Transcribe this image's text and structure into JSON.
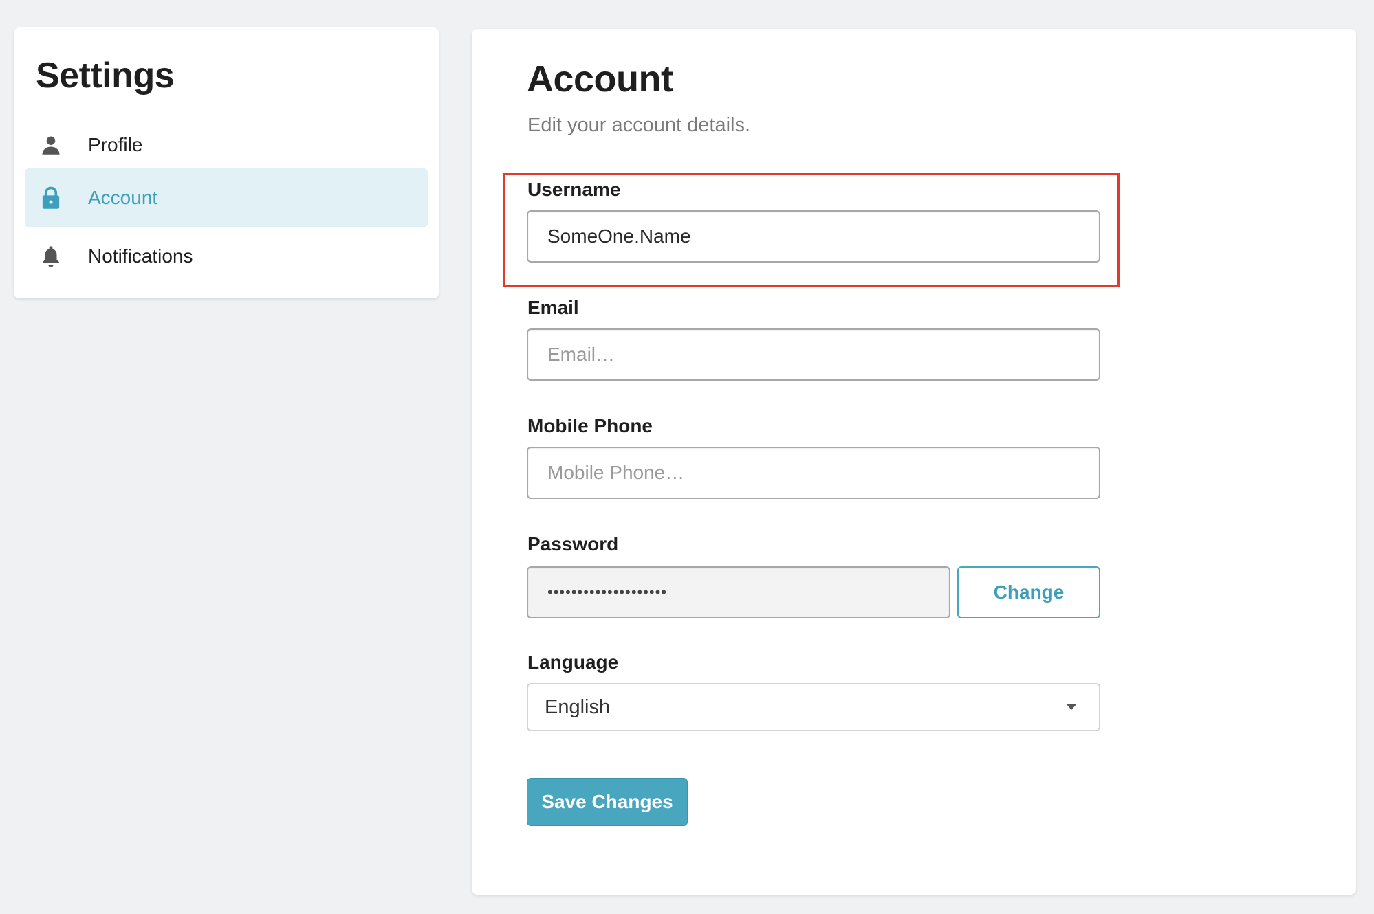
{
  "sidebar": {
    "title": "Settings",
    "items": [
      {
        "label": "Profile",
        "icon": "person-icon",
        "active": false
      },
      {
        "label": "Account",
        "icon": "lock-icon",
        "active": true
      },
      {
        "label": "Notifications",
        "icon": "bell-icon",
        "active": false
      }
    ]
  },
  "main": {
    "title": "Account",
    "subtitle": "Edit your account details.",
    "fields": {
      "username": {
        "label": "Username",
        "value": "SomeOne.Name"
      },
      "email": {
        "label": "Email",
        "value": "",
        "placeholder": "Email…"
      },
      "mobile": {
        "label": "Mobile Phone",
        "value": "",
        "placeholder": "Mobile Phone…"
      },
      "password": {
        "label": "Password",
        "masked_value": "••••••••••••••••••••",
        "change_label": "Change"
      },
      "language": {
        "label": "Language",
        "selected": "English"
      }
    },
    "save_label": "Save Changes"
  },
  "colors": {
    "accent": "#49a6bf",
    "active_bg": "#e2f1f6",
    "highlight": "#e03b2b",
    "background": "#f0f1f3"
  }
}
